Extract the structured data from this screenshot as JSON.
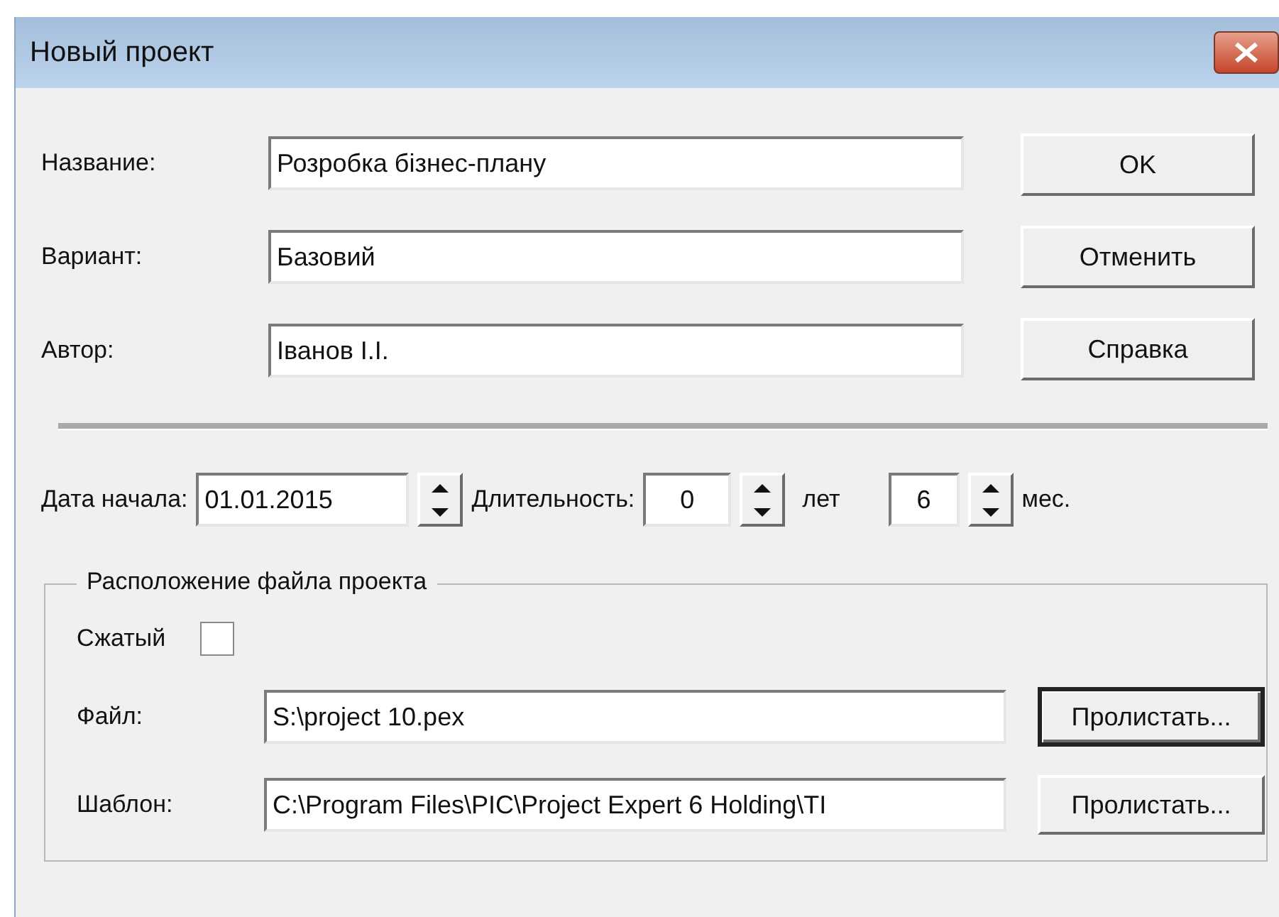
{
  "window": {
    "title": "Новый проект"
  },
  "fields": [
    {
      "label": "Название:",
      "value": "Розробка бізнес-плану"
    },
    {
      "label": "Вариант:",
      "value": "Базовий"
    },
    {
      "label": "Автор:",
      "value": "Іванов І.І."
    }
  ],
  "buttons": [
    "OK",
    "Отменить",
    "Справка"
  ],
  "start_date": {
    "label": "Дата начала:",
    "value": "01.01.2015"
  },
  "duration": {
    "label": "Длительность:",
    "years": "0",
    "years_unit": "лет",
    "months": "6",
    "months_unit": "мес."
  },
  "file_location": {
    "title": "Расположение файла проекта",
    "compressed": {
      "label": "Сжатый",
      "checked": false
    },
    "rows": [
      {
        "label": "Файл:",
        "value": "S:\\project 10.pex",
        "button": "Пролистать...",
        "default": true
      },
      {
        "label": "Шаблон:",
        "value": "C:\\Program Files\\PIC\\Project Expert 6 Holding\\TI",
        "button": "Пролистать...",
        "default": false
      }
    ]
  }
}
